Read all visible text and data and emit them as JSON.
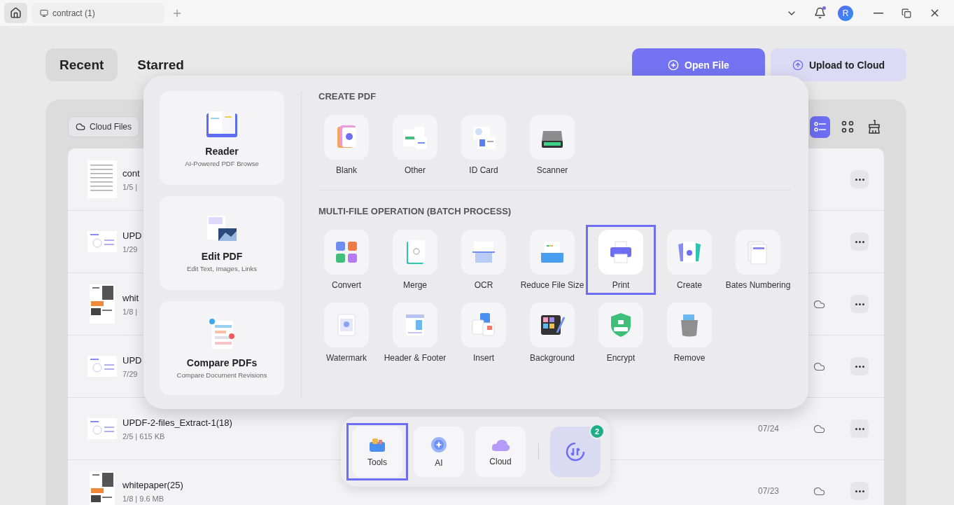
{
  "top_bar": {
    "tabs": [
      {
        "label": "contract (1)"
      }
    ],
    "avatar": "R"
  },
  "header": {
    "tabs": [
      {
        "label": "Recent",
        "selected": true
      },
      {
        "label": "Starred",
        "selected": false
      }
    ],
    "buttons": [
      {
        "label": "Open File",
        "kind": "primary"
      },
      {
        "label": "Upload to Cloud",
        "kind": "secondary"
      }
    ]
  },
  "toolbar": {
    "filter": "Cloud Files",
    "views": [
      {
        "selected": true
      },
      {
        "selected": false
      }
    ]
  },
  "files": [
    {
      "name": "cont",
      "meta": "1/5 |",
      "kind": "text-page",
      "synced": false
    },
    {
      "name": "UPD",
      "meta": "1/29",
      "kind": "chart-page",
      "synced": false
    },
    {
      "name": "whit",
      "meta": "1/8 |",
      "kind": "photo-page",
      "synced": true
    },
    {
      "name": "UPD",
      "meta": "7/29",
      "kind": "chart-page",
      "synced": true
    },
    {
      "name": "UPDF-2-files_Extract-1(18)",
      "meta": "2/5 | 615 KB",
      "date": "07/24",
      "kind": "chart-page",
      "synced": true
    },
    {
      "name": "whitepaper(25)",
      "meta": "1/8 | 9.6 MB",
      "date": "07/23",
      "kind": "photo-page",
      "synced": true
    }
  ],
  "tools_popup": {
    "cards": [
      {
        "title": "Reader",
        "subtitle": "AI-Powered PDF Browse"
      },
      {
        "title": "Edit PDF",
        "subtitle": "Edit Text, Images, Links"
      },
      {
        "title": "Compare PDFs",
        "subtitle": "Compare Document Revisions"
      }
    ],
    "sections": [
      {
        "heading": "CREATE PDF",
        "tools": [
          {
            "label": "Blank",
            "highlighted": false
          },
          {
            "label": "Other",
            "highlighted": false
          },
          {
            "label": "ID Card",
            "highlighted": false
          },
          {
            "label": "Scanner",
            "highlighted": false
          }
        ]
      },
      {
        "heading": "MULTI-FILE OPERATION (BATCH PROCESS)",
        "tools": [
          {
            "label": "Convert",
            "highlighted": false
          },
          {
            "label": "Merge",
            "highlighted": false
          },
          {
            "label": "OCR",
            "highlighted": false
          },
          {
            "label": "Reduce File Size",
            "highlighted": false
          },
          {
            "label": "Print",
            "highlighted": true
          },
          {
            "label": "Create",
            "highlighted": false
          },
          {
            "label": "Bates Numbering",
            "highlighted": false
          },
          {
            "label": "Watermark",
            "highlighted": false
          },
          {
            "label": "Header & Footer",
            "highlighted": false
          },
          {
            "label": "Insert",
            "highlighted": false
          },
          {
            "label": "Background",
            "highlighted": false
          },
          {
            "label": "Encrypt",
            "highlighted": false
          },
          {
            "label": "Remove",
            "highlighted": false
          }
        ]
      }
    ]
  },
  "dock": {
    "items": [
      {
        "label": "Tools",
        "highlighted": true
      },
      {
        "label": "AI",
        "highlighted": false
      },
      {
        "label": "Cloud",
        "highlighted": false
      }
    ],
    "badge": "2"
  }
}
